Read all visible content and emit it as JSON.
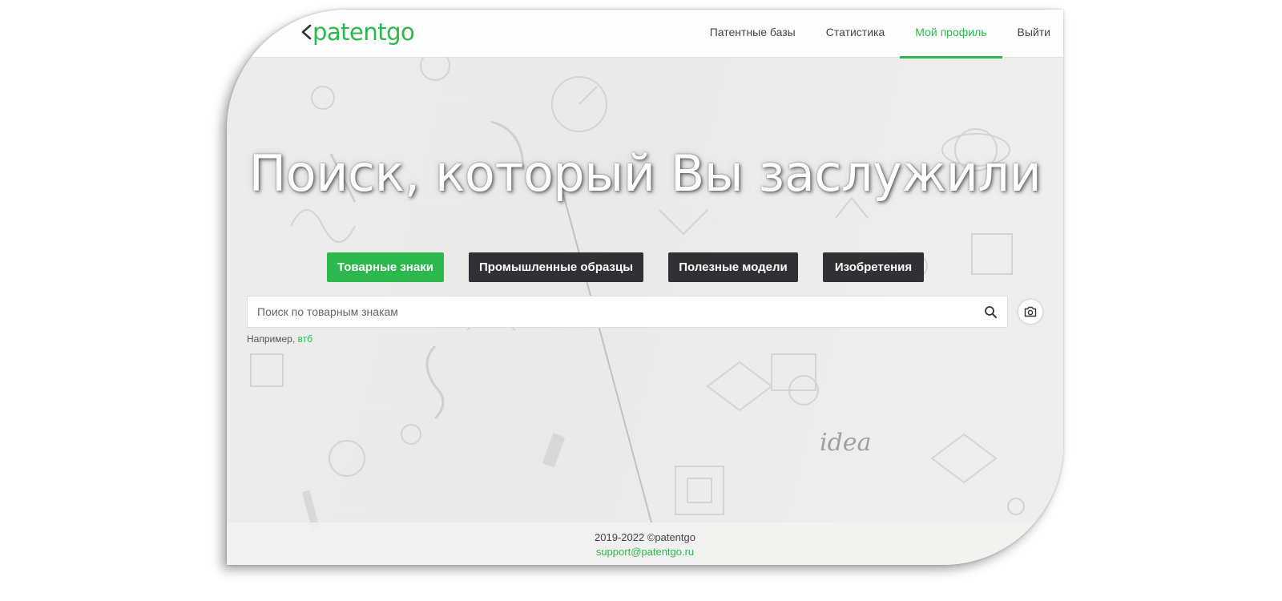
{
  "brand": {
    "logo_text": "patentgo",
    "accent": "#2db84e"
  },
  "nav": {
    "items": [
      {
        "label": "Патентные базы",
        "active": false
      },
      {
        "label": "Статистика",
        "active": false
      },
      {
        "label": "Мой профиль",
        "active": true
      },
      {
        "label": "Выйти",
        "active": false
      }
    ]
  },
  "hero": {
    "title": "Поиск, который Вы заслужили"
  },
  "tabs": [
    {
      "label": "Товарные знаки",
      "active": true
    },
    {
      "label": "Промышленные образцы",
      "active": false
    },
    {
      "label": "Полезные модели",
      "active": false
    },
    {
      "label": "Изобретения",
      "active": false
    }
  ],
  "search": {
    "placeholder": "Поиск по товарным знакам",
    "value": "",
    "search_icon": "search-icon",
    "image_search_icon": "camera-icon"
  },
  "example": {
    "prefix": "Например,",
    "link": "втб"
  },
  "footer": {
    "copyright": "2019-2022 ©patentgo",
    "email": "support@patentgo.ru"
  },
  "colors": {
    "tab_dark": "#2f3135",
    "tab_active": "#2db84e",
    "nav_text": "#444444"
  }
}
